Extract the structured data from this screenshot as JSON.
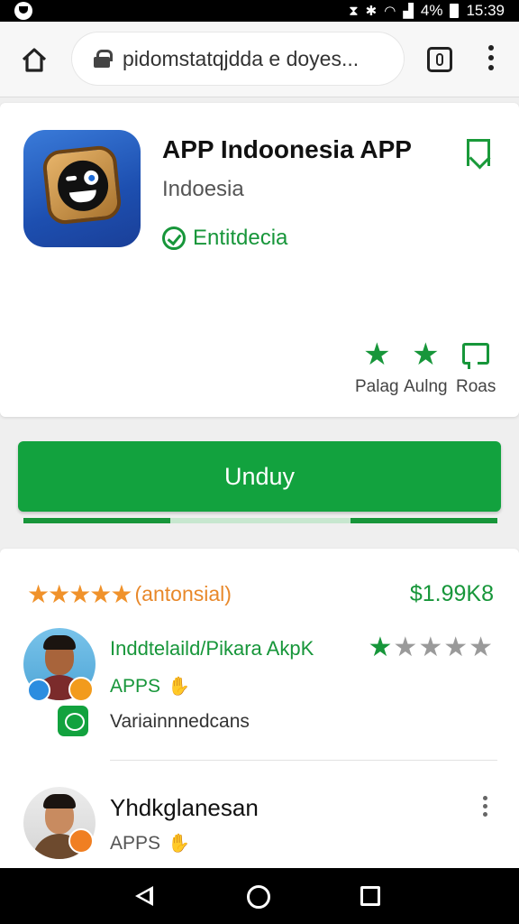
{
  "status_bar": {
    "battery": "4%",
    "time": "15:39"
  },
  "browser": {
    "url": "pidomstatqjdda e doyes..."
  },
  "app": {
    "title": "APP Indoonesia APP",
    "subtitle": "Indoesia",
    "verified_label": "Entitdecia",
    "stats": [
      {
        "label": "Palag",
        "icon": "star-icon"
      },
      {
        "label": "Aulng",
        "icon": "star-icon"
      },
      {
        "label": "Roas",
        "icon": "message-icon"
      }
    ]
  },
  "download": {
    "label": "Unduy",
    "progress_segments": [
      0.31,
      0.69,
      0.85
    ]
  },
  "list": {
    "rating_stars": "★★★★★",
    "rating_text": "(antonsial)",
    "price": "$1.99K8",
    "items": [
      {
        "title": "Inddtelaild/Pikara AkpK",
        "rating_stars": 1,
        "category": "APPS",
        "description": "Variainnnedcans"
      },
      {
        "title": "Yhdkglanesan",
        "category": "APPS"
      }
    ]
  },
  "colors": {
    "accent": "#12a23e",
    "rating": "#f0922b"
  }
}
